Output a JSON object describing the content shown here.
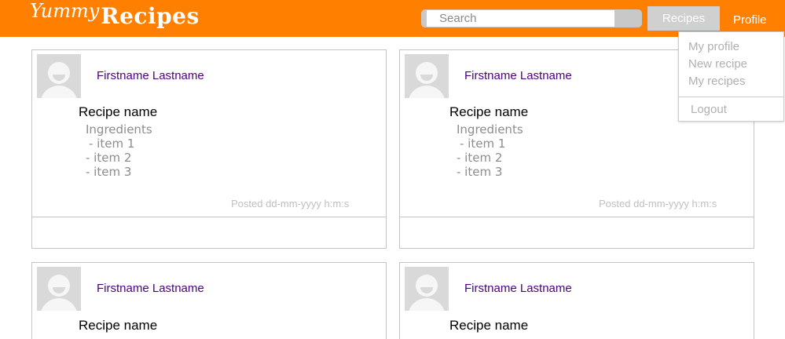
{
  "header": {
    "logo_part1": "Yummy",
    "logo_part2": "Recipes",
    "search_placeholder": "Search",
    "recipes_button": "Recipes",
    "profile_button": "Profile",
    "brand_color": "#ff7f00"
  },
  "profile_menu": {
    "items": [
      "My profile",
      "New recipe",
      "My recipes"
    ],
    "logout": "Logout"
  },
  "cards": [
    {
      "author": "Firstname Lastname",
      "recipe_name": "Recipe name",
      "ingredients_title": "Ingredients",
      "ingredients": [
        "- item 1",
        "- item 2",
        "- item 3"
      ],
      "posted": "Posted dd-mm-yyyy h:m:s"
    },
    {
      "author": "Firstname Lastname",
      "recipe_name": "Recipe name",
      "ingredients_title": "Ingredients",
      "ingredients": [
        "- item 1",
        "- item 2",
        "- item 3"
      ],
      "posted": "Posted dd-mm-yyyy h:m:s"
    },
    {
      "author": "Firstname Lastname",
      "recipe_name": "Recipe name"
    },
    {
      "author": "Firstname Lastname",
      "recipe_name": "Recipe name"
    }
  ]
}
